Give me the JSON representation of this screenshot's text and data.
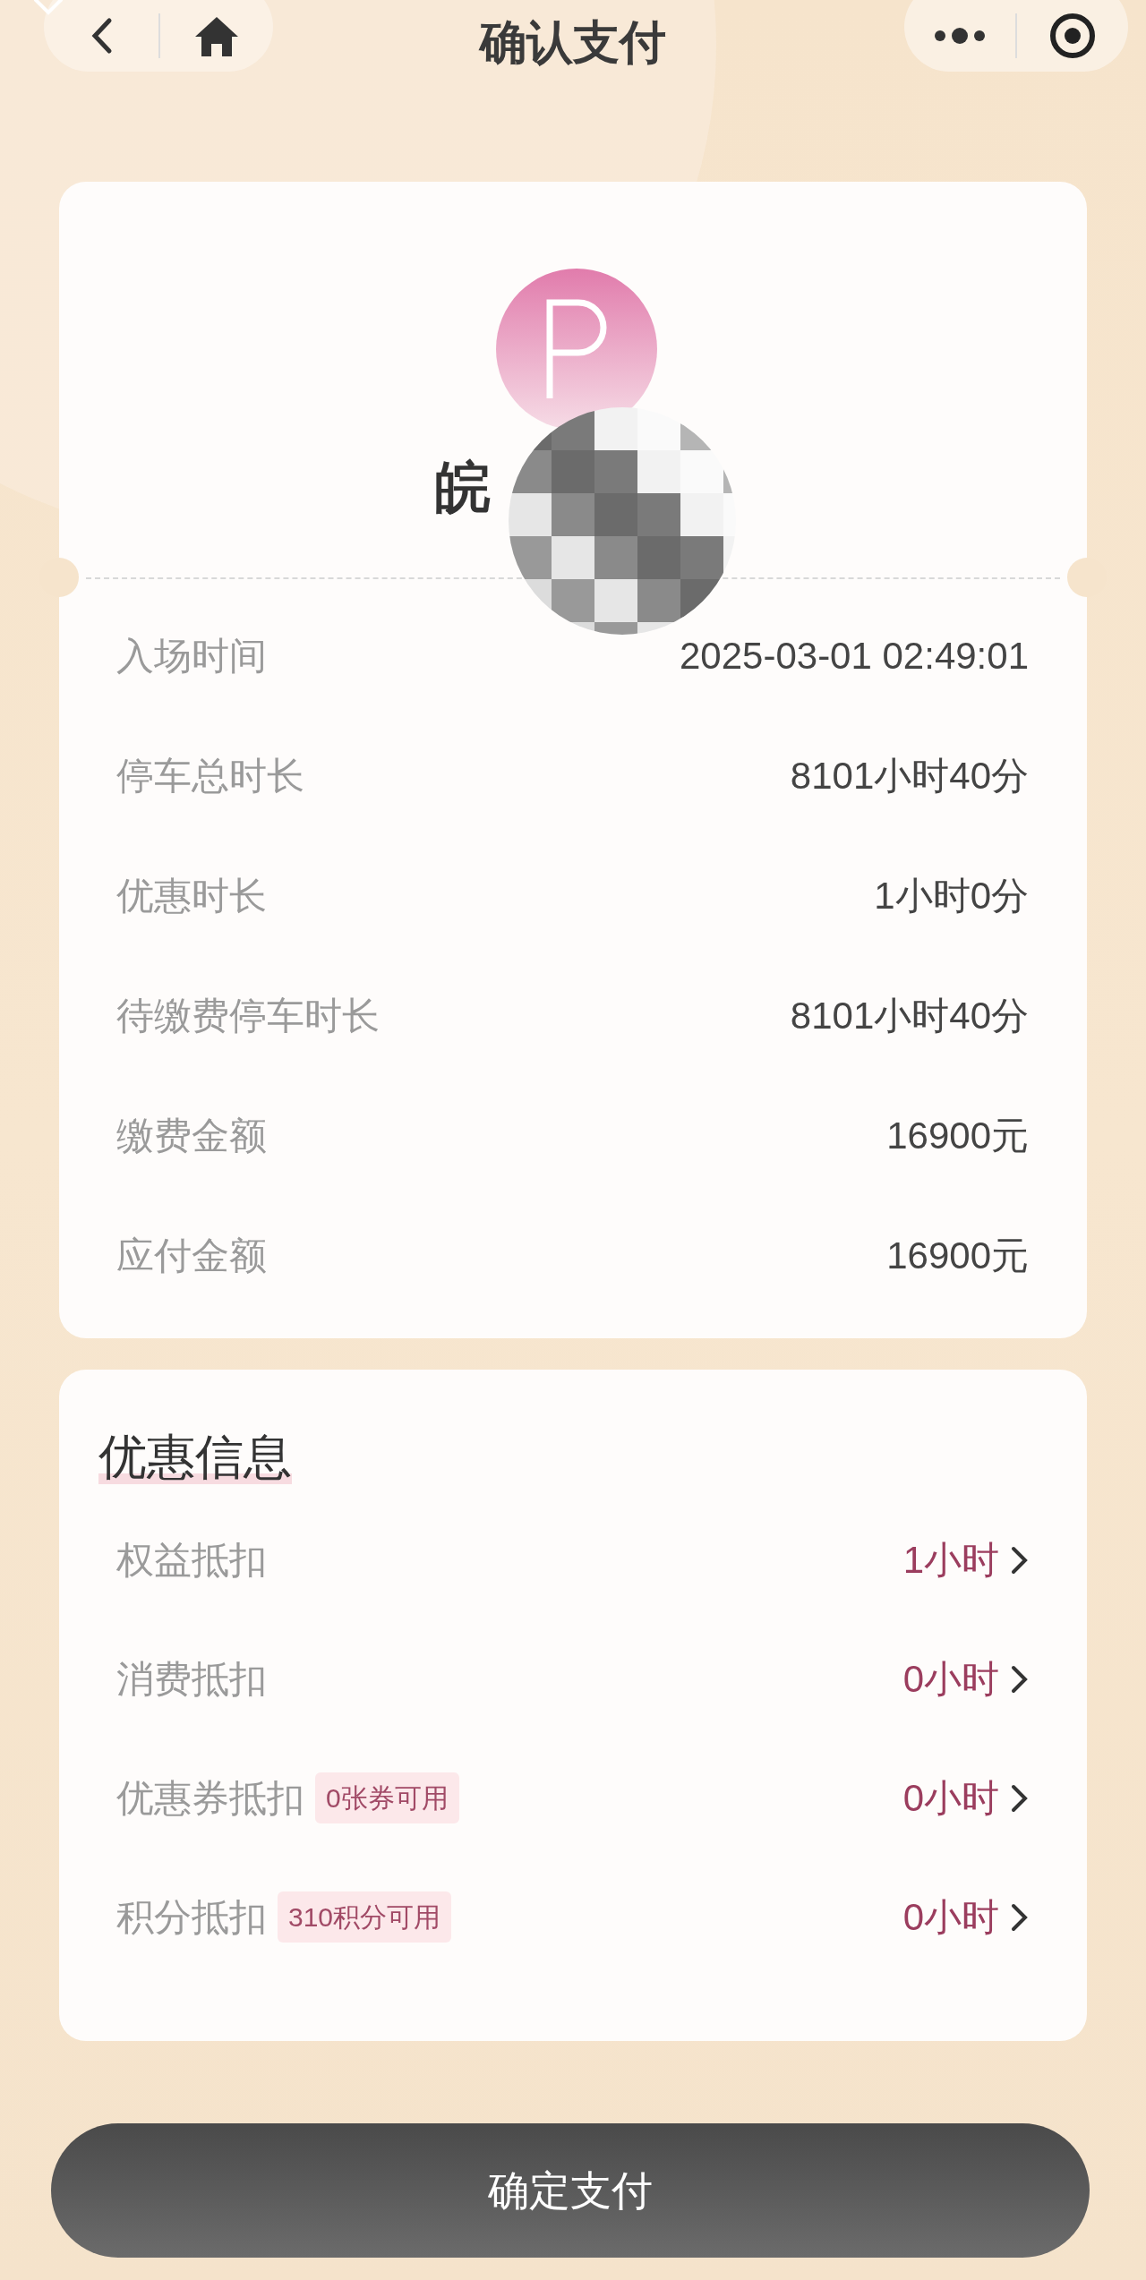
{
  "top_bar": {
    "title": "确认支付"
  },
  "parking": {
    "plate": "皖",
    "fields": [
      {
        "label": "入场时间",
        "value": "2025-03-01 02:49:01"
      },
      {
        "label": "停车总时长",
        "value": "8101小时40分"
      },
      {
        "label": "优惠时长",
        "value": "1小时0分"
      },
      {
        "label": "待缴费停车时长",
        "value": "8101小时40分"
      },
      {
        "label": "缴费金额",
        "value": "16900元"
      },
      {
        "label": "应付金额",
        "value": "16900元"
      }
    ]
  },
  "discounts": {
    "title": "优惠信息",
    "items": [
      {
        "label": "权益抵扣",
        "value": "1小时"
      },
      {
        "label": "消费抵扣",
        "value": "0小时"
      },
      {
        "label": "优惠券抵扣",
        "tag": "0张券可用",
        "value": "0小时"
      },
      {
        "label": "积分抵扣",
        "tag": "310积分可用",
        "value": "0小时"
      }
    ]
  },
  "confirm_button": "确定支付"
}
